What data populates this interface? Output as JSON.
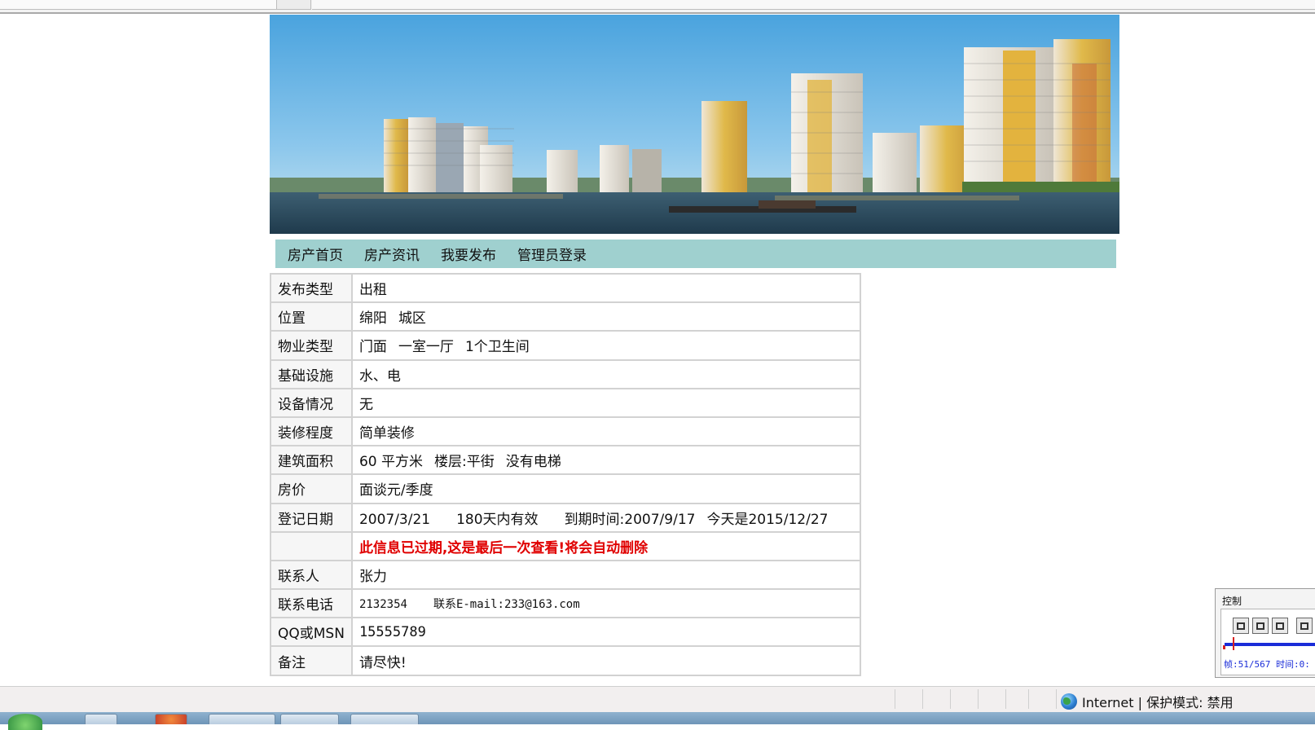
{
  "nav": {
    "items": [
      "房产首页",
      "房产资讯",
      "我要发布",
      "管理员登录"
    ]
  },
  "details": {
    "type_label": "发布类型",
    "type_value": "出租",
    "location_label": "位置",
    "location_city": "绵阳",
    "location_district": "城区",
    "property_label": "物业类型",
    "property_kind": "门面",
    "property_layout": "一室一厅",
    "property_bath": "1个卫生间",
    "facilities_label": "基础设施",
    "facilities_value": "水、电",
    "equipment_label": "设备情况",
    "equipment_value": "无",
    "decoration_label": "装修程度",
    "decoration_value": "简单装修",
    "area_label": "建筑面积",
    "area_value": "60 平方米",
    "floor_value": "楼层:平街",
    "elevator_value": "没有电梯",
    "price_label": "房价",
    "price_value": "面谈元/季度",
    "date_label": "登记日期",
    "date_value": "2007/3/21",
    "validity_value": "180天内有效",
    "expire_value": "到期时间:2007/9/17",
    "today_value": "今天是2015/12/27",
    "expired_notice": "此信息已过期,这是最后一次查看!将会自动删除",
    "contact_label": "联系人",
    "contact_value": "张力",
    "phone_label": "联系电话",
    "phone_value": "2132354",
    "email_value": "联系E-mail:233@163.com",
    "qq_label": "QQ或MSN",
    "qq_value": "15555789",
    "note_label": "备注",
    "note_value": "请尽快!"
  },
  "statusbar": {
    "zone": "Internet | 保护模式: 禁用",
    "icon": "globe-icon"
  },
  "control_panel": {
    "title": "控制",
    "readout": "帧:51/567 时间:0:",
    "progress": 0.09,
    "track_color": "#1a2cd8",
    "thumb_color": "#d92020"
  },
  "colors": {
    "nav_bg": "#9fd0cf",
    "warning_text": "#e00000"
  }
}
